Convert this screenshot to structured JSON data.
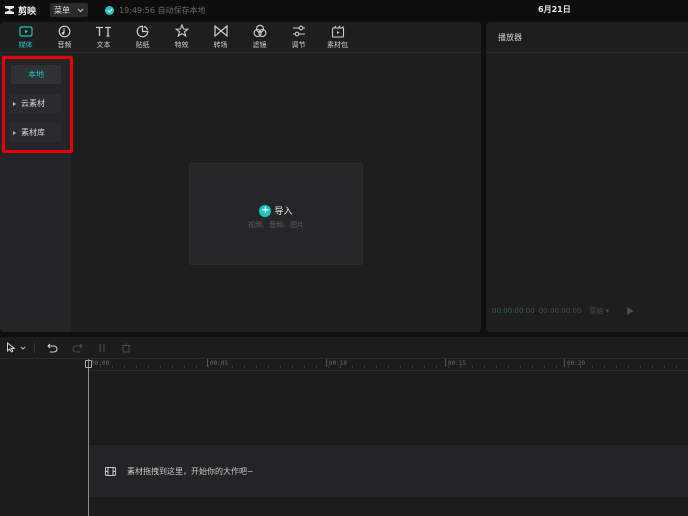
{
  "app": {
    "name": "剪映",
    "menu_label": "菜单",
    "save_status": "19:49:56 自动保存本地",
    "project_title": "6月21日"
  },
  "toolbar": {
    "items": [
      {
        "id": "media",
        "label": "媒体",
        "icon": "media-icon",
        "active": true
      },
      {
        "id": "audio",
        "label": "音频",
        "icon": "audio-icon",
        "active": false
      },
      {
        "id": "text",
        "label": "文本",
        "icon": "text-icon",
        "active": false
      },
      {
        "id": "sticker",
        "label": "贴纸",
        "icon": "sticker-icon",
        "active": false
      },
      {
        "id": "effects",
        "label": "特效",
        "icon": "effects-icon",
        "active": false
      },
      {
        "id": "transition",
        "label": "转场",
        "icon": "transition-icon",
        "active": false
      },
      {
        "id": "filter",
        "label": "滤镜",
        "icon": "filter-icon",
        "active": false
      },
      {
        "id": "adjust",
        "label": "调节",
        "icon": "adjust-icon",
        "active": false
      },
      {
        "id": "pack",
        "label": "素材包",
        "icon": "pack-icon",
        "active": false
      }
    ]
  },
  "sidebar": {
    "items": [
      {
        "label": "本地",
        "active": true
      },
      {
        "label": "云素材",
        "active": false
      },
      {
        "label": "素材库",
        "active": false
      }
    ]
  },
  "import": {
    "label": "导入",
    "hint": "视频、音频、图片"
  },
  "player": {
    "title": "播放器",
    "current_time": "00:00:00:00",
    "total_time": "00:00:00:00",
    "ratio": "原始"
  },
  "timeline": {
    "ticks": [
      "00:00",
      "00:05",
      "00:10",
      "00:15",
      "00:20"
    ],
    "drop_hint": "素材拖拽到这里，开始你的大作吧~"
  },
  "colors": {
    "accent": "#1ec3c5",
    "highlight": "#e5000a",
    "background": "#0f0f10",
    "panel": "#1e1e1f"
  }
}
